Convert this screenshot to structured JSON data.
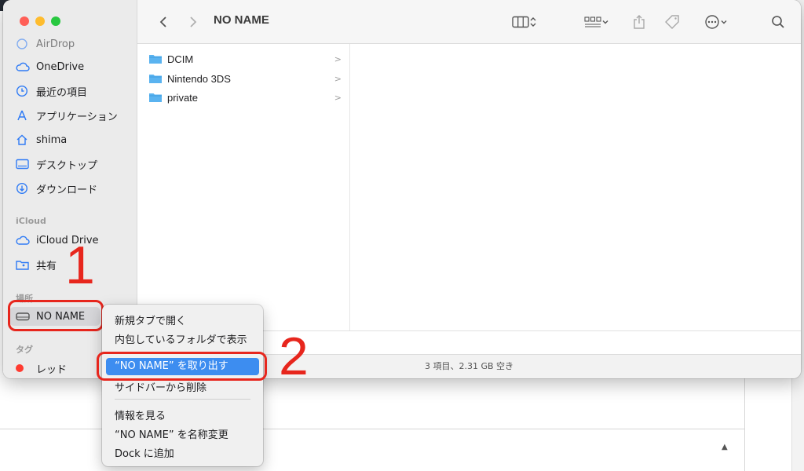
{
  "window": {
    "title": "NO NAME",
    "status_text": "3 項目、2.31 GB 空き"
  },
  "sidebar": {
    "items": [
      {
        "label": "AirDrop",
        "icon": "airdrop-icon"
      },
      {
        "label": "OneDrive",
        "icon": "cloud-icon"
      },
      {
        "label": "最近の項目",
        "icon": "clock-icon"
      },
      {
        "label": "アプリケーション",
        "icon": "applications-icon"
      },
      {
        "label": "shima",
        "icon": "home-icon"
      },
      {
        "label": "デスクトップ",
        "icon": "desktop-icon"
      },
      {
        "label": "ダウンロード",
        "icon": "download-icon"
      }
    ],
    "icloud_section": "iCloud",
    "icloud_items": [
      {
        "label": "iCloud Drive",
        "icon": "icloud-icon"
      },
      {
        "label": "共有",
        "icon": "shared-folder-icon"
      }
    ],
    "locations_section": "場所",
    "locations_items": [
      {
        "label": "NO NAME",
        "icon": "drive-icon"
      }
    ],
    "tags_section": "タグ",
    "tags_items": [
      {
        "label": "レッド",
        "color": "#ff3b30"
      }
    ]
  },
  "files": [
    {
      "name": "DCIM",
      "type": "folder"
    },
    {
      "name": "Nintendo 3DS",
      "type": "folder"
    },
    {
      "name": "private",
      "type": "folder"
    }
  ],
  "context_menu": {
    "items": [
      "新規タブで開く",
      "内包しているフォルダで表示",
      "“NO NAME” を取り出す",
      "サイドバーから削除",
      "情報を見る",
      "“NO NAME” を名称変更",
      "Dock に追加"
    ],
    "selected_index": 2
  },
  "annotations": {
    "step1": "1",
    "step2": "2"
  },
  "colors": {
    "accent": "#3d8df0",
    "annotation_red": "#e7261d",
    "folder_blue": "#5ab3f0",
    "tag_red": "#ff3b30"
  }
}
